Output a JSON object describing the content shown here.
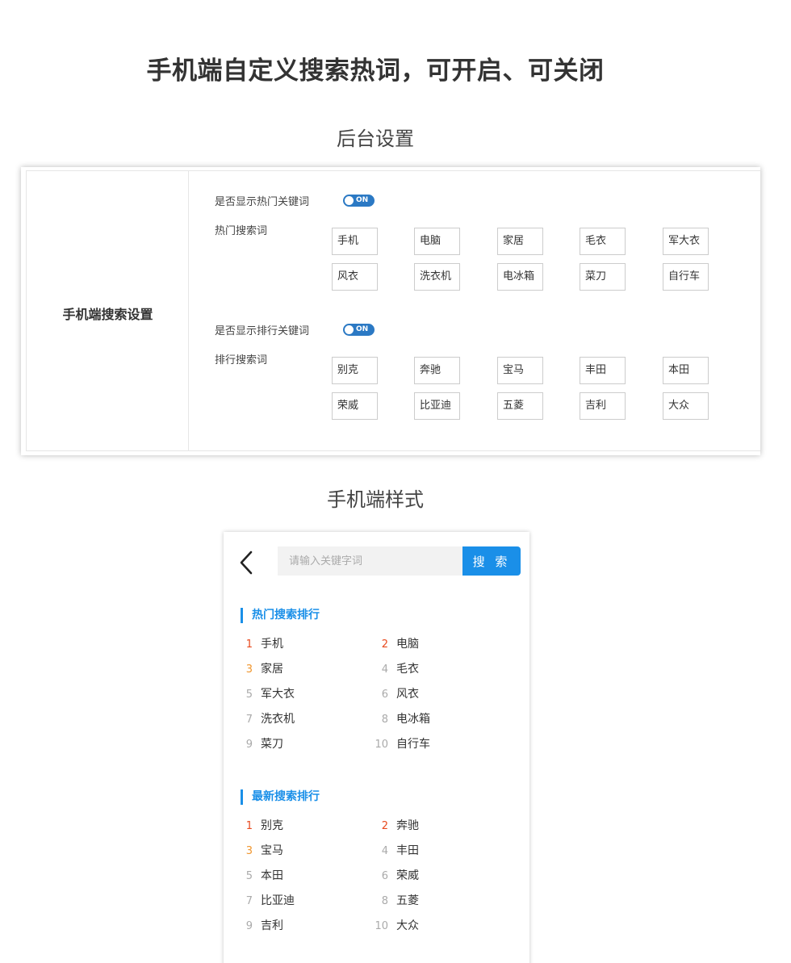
{
  "title": "手机端自定义搜索热词，可开启、可关闭",
  "admin": {
    "section_title": "后台设置",
    "left_label": "手机端搜索设置",
    "hot": {
      "toggle_label": "是否显示热门关键词",
      "toggle_text": "ON",
      "words_label": "热门搜索词",
      "words": [
        "手机",
        "电脑",
        "家居",
        "毛衣",
        "军大衣",
        "风衣",
        "洗衣机",
        "电冰箱",
        "菜刀",
        "自行车"
      ]
    },
    "rank": {
      "toggle_label": "是否显示排行关键词",
      "toggle_text": "ON",
      "words_label": "排行搜索词",
      "words": [
        "别克",
        "奔驰",
        "宝马",
        "丰田",
        "本田",
        "荣威",
        "比亚迪",
        "五菱",
        "吉利",
        "大众"
      ]
    }
  },
  "mobile": {
    "section_title": "手机端样式",
    "search": {
      "placeholder": "请输入关键字词",
      "button_label": "搜 索"
    },
    "hot_list": {
      "title": "热门搜索排行",
      "items": [
        "手机",
        "电脑",
        "家居",
        "毛衣",
        "军大衣",
        "风衣",
        "洗衣机",
        "电冰箱",
        "菜刀",
        "自行车"
      ]
    },
    "new_list": {
      "title": "最新搜索排行",
      "items": [
        "别克",
        "奔驰",
        "宝马",
        "丰田",
        "本田",
        "荣威",
        "比亚迪",
        "五菱",
        "吉利",
        "大众"
      ]
    },
    "rank_numbers": [
      "1",
      "2",
      "3",
      "4",
      "5",
      "6",
      "7",
      "8",
      "9",
      "10"
    ]
  },
  "colors": {
    "accent": "#1a8fe8",
    "toggle": "#2b79c4",
    "rank_top": "#e8491d",
    "rank_third": "#f0962e",
    "rank_rest": "#aaaaaa"
  },
  "icons": {
    "back": "chevron-left-icon",
    "toggle": "toggle-switch-icon"
  }
}
